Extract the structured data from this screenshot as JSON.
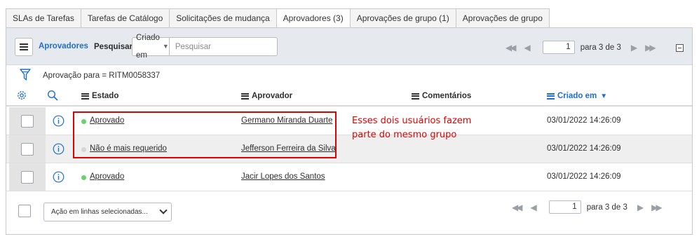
{
  "tabs": [
    {
      "label": "SLAs de Tarefas",
      "active": false
    },
    {
      "label": "Tarefas de Catálogo",
      "active": false
    },
    {
      "label": "Solicitações de mudança",
      "active": false
    },
    {
      "label": "Aprovadores (3)",
      "active": true
    },
    {
      "label": "Aprovações de grupo (1)",
      "active": false
    },
    {
      "label": "Aprovações de grupo",
      "active": false
    }
  ],
  "toolbar": {
    "menu_icon": "hamburger-icon",
    "list_title": "Aprovadores",
    "search_label": "Pesquisar",
    "search_field": "Criado em",
    "search_placeholder": "Pesquisar"
  },
  "pager_top": {
    "page": "1",
    "page_of": "para 3 de 3"
  },
  "filter": {
    "icon": "filter-icon",
    "breadcrumb": "Aprovação para = RITM0058337"
  },
  "columns": {
    "estado": "Estado",
    "aprovador": "Aprovador",
    "comentarios": "Comentários",
    "criado_em": "Criado em",
    "sorted": "criado_em",
    "sort_direction": "desc"
  },
  "rows": [
    {
      "estado": "Aprovado",
      "dot_color": "#6fcf6f",
      "aprovador": "Germano Miranda Duarte",
      "comentarios": "",
      "criado_em": "03/01/2022 14:26:09"
    },
    {
      "estado": "Não é mais requerido",
      "dot_color": "#d6d6d6",
      "aprovador": "Jefferson Ferreira da Silva",
      "comentarios": "",
      "criado_em": "03/01/2022 14:26:09"
    },
    {
      "estado": "Aprovado",
      "dot_color": "#6fcf6f",
      "aprovador": "Jacir Lopes dos Santos",
      "comentarios": "",
      "criado_em": "03/01/2022 14:26:09"
    }
  ],
  "annotation": {
    "text": "Esses dois usuários fazem parte do mesmo grupo",
    "color": "#e00000"
  },
  "footer": {
    "action_placeholder": "Ação em linhas selecionadas...",
    "page": "1",
    "page_of": "para 3 de 3"
  },
  "colors": {
    "accent": "#1f6fcf",
    "approved": "#6fcf6f",
    "not_required": "#d6d6d6"
  }
}
